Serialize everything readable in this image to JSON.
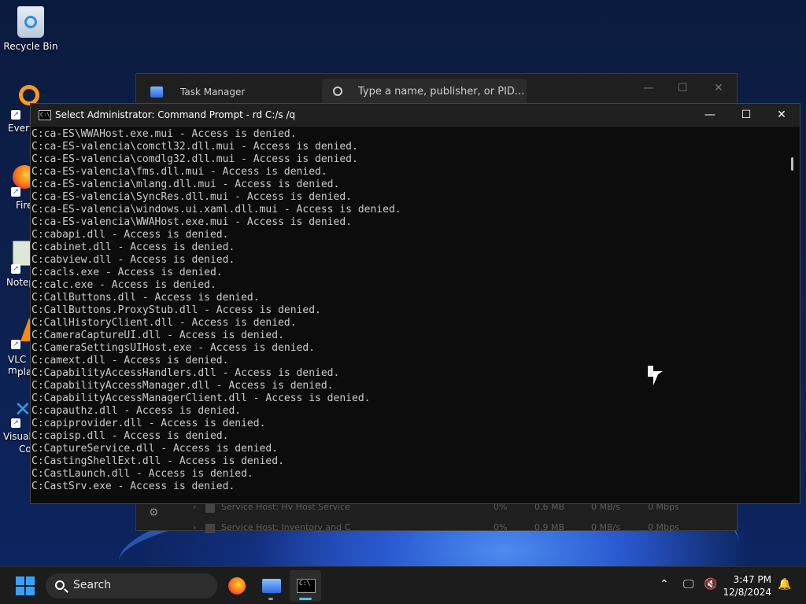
{
  "desktop": {
    "recycle_bin": "Recycle Bin",
    "partial_labels": [
      "Every",
      "Fire",
      "Notep",
      "VLC m",
      "pla",
      "Visual",
      "Co"
    ]
  },
  "task_manager": {
    "title": "Task Manager",
    "search_placeholder": "Type a name, publisher, or PID...",
    "rows": [
      {
        "name": "Service Host: Hv Host Service",
        "cpu": "0%",
        "mem": "0.6 MB",
        "disk": "0 MB/s",
        "net": "0 Mbps"
      },
      {
        "name": "Service Host: Inventory and C",
        "cpu": "0%",
        "mem": "0.9 MB",
        "disk": "0 MB/s",
        "net": "0 Mbps"
      }
    ]
  },
  "cmd": {
    "title": "Select Administrator: Command Prompt - rd  C:/s /q",
    "lines": [
      "C:ca-ES\\WWAHost.exe.mui - Access is denied.",
      "C:ca-ES-valencia\\comctl32.dll.mui - Access is denied.",
      "C:ca-ES-valencia\\comdlg32.dll.mui - Access is denied.",
      "C:ca-ES-valencia\\fms.dll.mui - Access is denied.",
      "C:ca-ES-valencia\\mlang.dll.mui - Access is denied.",
      "C:ca-ES-valencia\\SyncRes.dll.mui - Access is denied.",
      "C:ca-ES-valencia\\windows.ui.xaml.dll.mui - Access is denied.",
      "C:ca-ES-valencia\\WWAHost.exe.mui - Access is denied.",
      "C:cabapi.dll - Access is denied.",
      "C:cabinet.dll - Access is denied.",
      "C:cabview.dll - Access is denied.",
      "C:cacls.exe - Access is denied.",
      "C:calc.exe - Access is denied.",
      "C:CallButtons.dll - Access is denied.",
      "C:CallButtons.ProxyStub.dll - Access is denied.",
      "C:CallHistoryClient.dll - Access is denied.",
      "C:CameraCaptureUI.dll - Access is denied.",
      "C:CameraSettingsUIHost.exe - Access is denied.",
      "C:camext.dll - Access is denied.",
      "C:CapabilityAccessHandlers.dll - Access is denied.",
      "C:CapabilityAccessManager.dll - Access is denied.",
      "C:CapabilityAccessManagerClient.dll - Access is denied.",
      "C:capauthz.dll - Access is denied.",
      "C:capiprovider.dll - Access is denied.",
      "C:capisp.dll - Access is denied.",
      "C:CaptureService.dll - Access is denied.",
      "C:CastingShellExt.dll - Access is denied.",
      "C:CastLaunch.dll - Access is denied.",
      "C:CastSrv.exe - Access is denied."
    ]
  },
  "taskbar": {
    "search_label": "Search",
    "time": "3:47 PM",
    "date": "12/8/2024"
  },
  "colors": {
    "accent": "#3aa0ff",
    "console_bg": "#0c0c0c",
    "console_text": "#cccccc"
  }
}
